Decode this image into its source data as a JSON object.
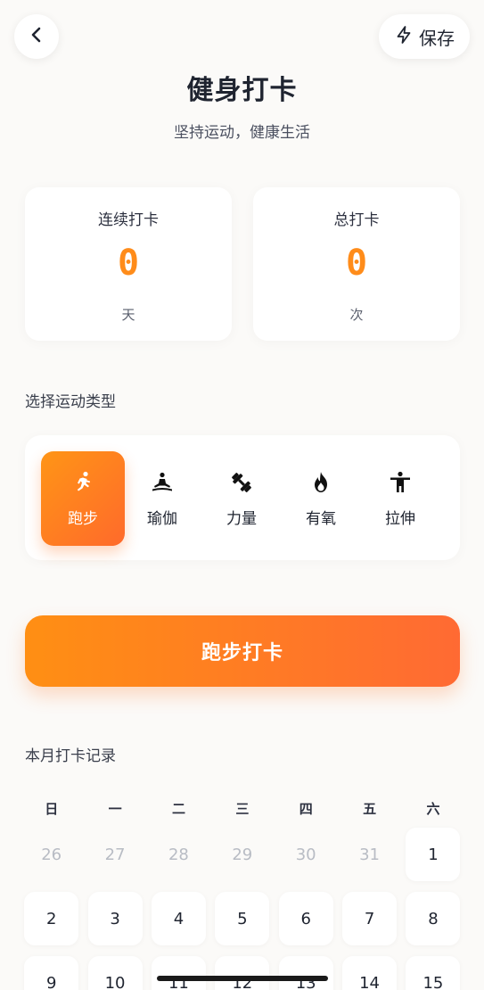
{
  "header": {
    "back_icon": "chevron-left-icon",
    "save_icon": "lightning-icon",
    "save_label": "保存"
  },
  "page": {
    "title": "健身打卡",
    "subtitle": "坚持运动，健康生活"
  },
  "stats": [
    {
      "label": "连续打卡",
      "value": "0",
      "unit": "天"
    },
    {
      "label": "总打卡",
      "value": "0",
      "unit": "次"
    }
  ],
  "exercise_section": {
    "label": "选择运动类型",
    "types": [
      {
        "label": "跑步",
        "icon": "running-icon",
        "active": true
      },
      {
        "label": "瑜伽",
        "icon": "yoga-icon",
        "active": false
      },
      {
        "label": "力量",
        "icon": "dumbbell-icon",
        "active": false
      },
      {
        "label": "有氧",
        "icon": "flame-icon",
        "active": false
      },
      {
        "label": "拉伸",
        "icon": "stretch-icon",
        "active": false
      }
    ]
  },
  "checkin_button": {
    "label": "跑步打卡"
  },
  "calendar": {
    "label": "本月打卡记录",
    "weekdays": [
      "日",
      "一",
      "二",
      "三",
      "四",
      "五",
      "六"
    ],
    "rows": [
      [
        {
          "d": "26",
          "cur": false
        },
        {
          "d": "27",
          "cur": false
        },
        {
          "d": "28",
          "cur": false
        },
        {
          "d": "29",
          "cur": false
        },
        {
          "d": "30",
          "cur": false
        },
        {
          "d": "31",
          "cur": false
        },
        {
          "d": "1",
          "cur": true
        }
      ],
      [
        {
          "d": "2",
          "cur": true
        },
        {
          "d": "3",
          "cur": true
        },
        {
          "d": "4",
          "cur": true
        },
        {
          "d": "5",
          "cur": true
        },
        {
          "d": "6",
          "cur": true
        },
        {
          "d": "7",
          "cur": true
        },
        {
          "d": "8",
          "cur": true
        }
      ],
      [
        {
          "d": "9",
          "cur": true
        },
        {
          "d": "10",
          "cur": true
        },
        {
          "d": "11",
          "cur": true
        },
        {
          "d": "12",
          "cur": true
        },
        {
          "d": "13",
          "cur": true
        },
        {
          "d": "14",
          "cur": true
        },
        {
          "d": "15",
          "cur": true
        }
      ]
    ]
  },
  "colors": {
    "accent_start": "#ff9516",
    "accent_end": "#ff6a2b",
    "stat_value": "#ff8c1a",
    "background": "#fbfaf8"
  }
}
